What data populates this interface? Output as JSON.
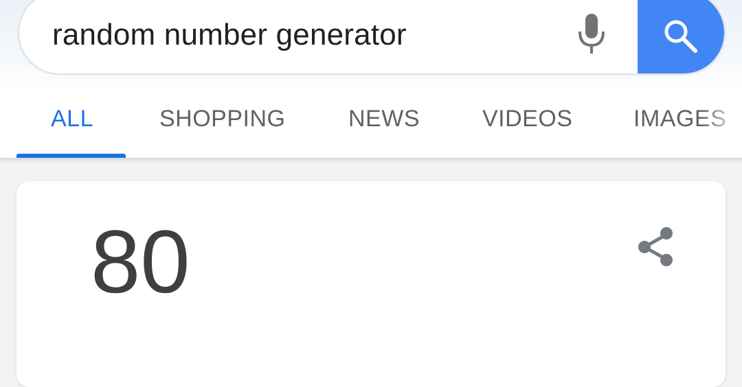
{
  "search": {
    "query": "random number generator",
    "mic_icon": "microphone-icon",
    "search_icon": "magnifier-icon",
    "accent_color": "#4285f4"
  },
  "tabs": [
    {
      "label": "ALL",
      "active": true
    },
    {
      "label": "SHOPPING",
      "active": false
    },
    {
      "label": "NEWS",
      "active": false
    },
    {
      "label": "VIDEOS",
      "active": false
    },
    {
      "label": "IMAGES",
      "active": false
    }
  ],
  "colors": {
    "active_tab": "#1a73e8",
    "inactive_tab": "#5f6368"
  },
  "result_card": {
    "value": "80",
    "share_icon": "share-icon"
  }
}
